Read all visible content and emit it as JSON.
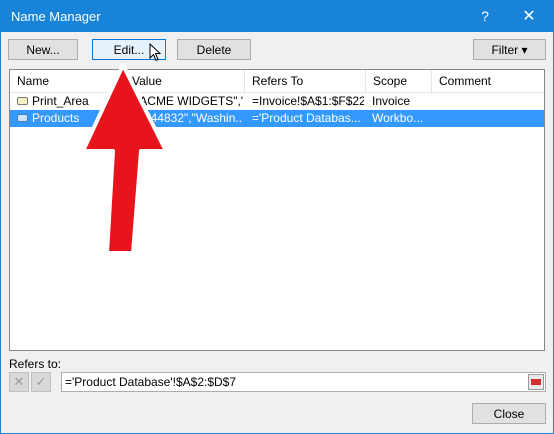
{
  "window": {
    "title": "Name Manager"
  },
  "titlebar": {
    "help": "?",
    "close": "✕"
  },
  "toolbar": {
    "new_label": "New...",
    "edit_label": "Edit...",
    "delete_label": "Delete",
    "filter_label": "Filter",
    "filter_arrow": "▾"
  },
  "list": {
    "headers": [
      "Name",
      "Value",
      "Refers To",
      "Scope",
      "Comment"
    ],
    "rows": [
      {
        "name": "Print_Area",
        "value": "{\"ACME WIDGETS\",\"...",
        "refers_to": "=Invoice!$A$1:$F$22",
        "scope": "Invoice",
        "comment": ""
      },
      {
        "name": "Products",
        "value": "{\"W44832\",\"Washin...",
        "refers_to": "='Product Databas...",
        "scope": "Workbo...",
        "comment": ""
      }
    ]
  },
  "refers": {
    "label": "Refers to:",
    "value": "='Product Database'!$A$2:$D$7",
    "cancel": "✕",
    "accept": "✓"
  },
  "footer": {
    "close_label": "Close"
  },
  "colors": {
    "title_bar": "#1883d7",
    "selection": "#3399ff",
    "annotation_arrow": "#e8141b"
  }
}
